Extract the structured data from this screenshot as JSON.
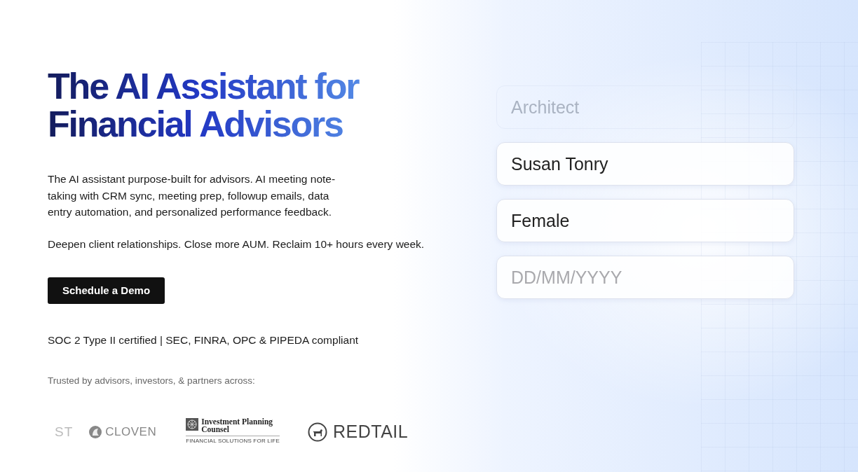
{
  "hero": {
    "title": "The AI Assistant for Financial Advisors",
    "description": "The AI assistant purpose-built for advisors. AI meeting note-taking with CRM sync, meeting prep, followup emails, data entry automation, and personalized performance feedback.",
    "tagline": "Deepen client relationships. Close more AUM. Reclaim 10+ hours every week.",
    "cta": "Schedule a Demo",
    "compliance": "SOC 2 Type II certified | SEC, FINRA, OPC & PIPEDA compliant",
    "trusted_label": "Trusted by advisors, investors, & partners across:"
  },
  "logos": [
    {
      "kind": "partial",
      "text": "ST"
    },
    {
      "kind": "cloven",
      "text": "CLOVEN"
    },
    {
      "kind": "ipc",
      "text": "Investment Planning Counsel",
      "subtext": "FINANCIAL SOLUTIONS FOR LIFE"
    },
    {
      "kind": "redtail",
      "text": "REDTAIL"
    }
  ],
  "form_fields": [
    {
      "value": "Architect",
      "faded": true
    },
    {
      "value": "Susan Tonry",
      "faded": false
    },
    {
      "value": "Female",
      "faded": false
    },
    {
      "placeholder": "DD/MM/YYYY",
      "faded": false
    }
  ]
}
